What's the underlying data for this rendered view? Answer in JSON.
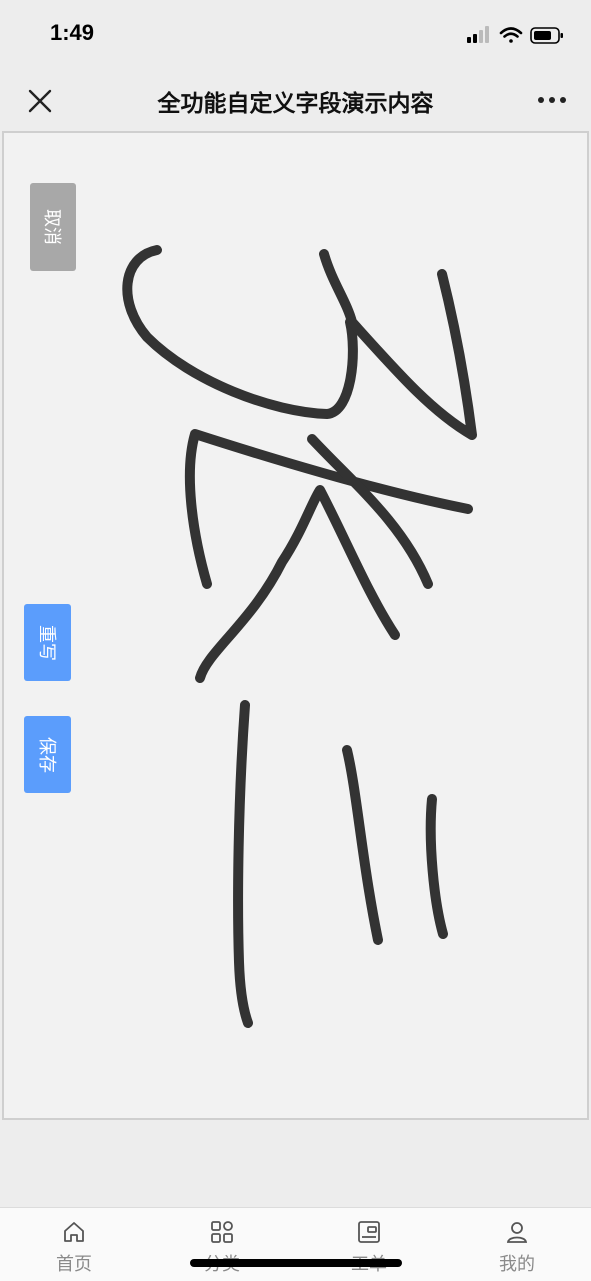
{
  "status": {
    "time": "1:49"
  },
  "nav": {
    "title": "全功能自定义字段演示内容"
  },
  "buttons": {
    "cancel": "取消",
    "rewrite": "重写",
    "save": "保存"
  },
  "tabs": [
    {
      "label": "首页",
      "icon": "home-icon"
    },
    {
      "label": "分类",
      "icon": "grid-icon"
    },
    {
      "label": "工单",
      "icon": "ticket-icon"
    },
    {
      "label": "我的",
      "icon": "user-icon"
    }
  ],
  "colors": {
    "accent": "#5b9dfc",
    "cancel": "#a8a8a8",
    "ink": "#333333"
  }
}
